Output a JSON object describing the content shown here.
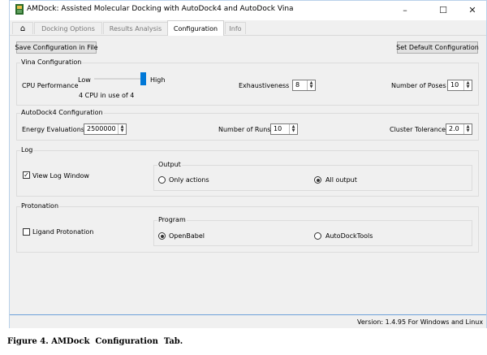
{
  "window": {
    "title": "AMDock: Assisted Molecular Docking with AutoDock4 and AutoDock Vina",
    "controls": {
      "minimize": "–",
      "maximize": "☐",
      "close": "✕"
    }
  },
  "tabs": [
    {
      "label": "⌂",
      "icon": "home-icon"
    },
    {
      "label": "Docking Options"
    },
    {
      "label": "Results Analysis"
    },
    {
      "label": "Configuration",
      "active": true
    },
    {
      "label": "Info"
    }
  ],
  "toolbar": {
    "save_label": "Save Configuration in File",
    "default_label": "Set Default Configuration"
  },
  "vina": {
    "title": "Vina Configuration",
    "cpu_label": "CPU Performance",
    "low_label": "Low",
    "high_label": "High",
    "cpu_status": "4 CPU in use of 4",
    "cpu_level": 1.0,
    "exhaustiveness_label": "Exhaustiveness",
    "exhaustiveness_value": "8",
    "poses_label": "Number of Poses",
    "poses_value": "10"
  },
  "autodock4": {
    "title": "AutoDock4 Configuration",
    "energy_label": "Energy Evaluations",
    "energy_value": "2500000",
    "runs_label": "Number of Runs",
    "runs_value": "10",
    "tolerance_label": "Cluster Tolerance",
    "tolerance_value": "2.0"
  },
  "log": {
    "title": "Log",
    "view_log_label": "View Log Window",
    "view_log_checked": true,
    "output_title": "Output",
    "only_actions_label": "Only actions",
    "all_output_label": "All output",
    "selected": "All output"
  },
  "protonation": {
    "title": "Protonation",
    "ligand_label": "Ligand Protonation",
    "ligand_checked": false,
    "program_title": "Program",
    "openbabel_label": "OpenBabel",
    "autodocktools_label": "AutoDockTools",
    "selected": "OpenBabel"
  },
  "status": {
    "version": "Version: 1.4.95 For Windows and Linux"
  },
  "caption": "Figure 4. AMDock  Configuration  Tab."
}
